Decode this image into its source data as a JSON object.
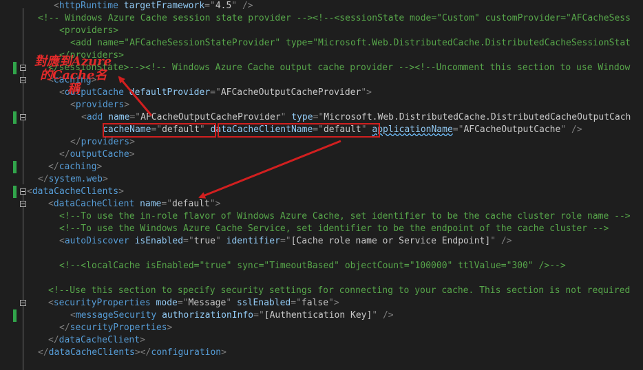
{
  "code_lines": [
    [
      [
        "p",
        "<"
      ],
      [
        "e",
        "httpRuntime"
      ],
      [
        "t",
        " "
      ],
      [
        "a",
        "targetFramework"
      ],
      [
        "p",
        "=\""
      ],
      [
        "v",
        "4.5"
      ],
      [
        "p",
        "\" />"
      ]
    ],
    [
      [
        "c",
        "<!-- Windows Azure Cache session state provider -->"
      ],
      [
        "c",
        "<!--<sessionState mode=\"Custom\" customProvider=\"AFCacheSess"
      ]
    ],
    [
      [
        "c",
        "<providers>"
      ]
    ],
    [
      [
        "c",
        "<add name=\"AFCacheSessionStateProvider\" type=\"Microsoft.Web.DistributedCache.DistributedCacheSessionStat"
      ]
    ],
    [
      [
        "c",
        "</providers>"
      ]
    ],
    [
      [
        "c",
        "</sessionState>-->"
      ],
      [
        "c",
        "<!-- Windows Azure Cache output cache provider -->"
      ],
      [
        "c",
        "<!--Uncomment this section to use Window"
      ]
    ],
    [
      [
        "p",
        "<"
      ],
      [
        "e",
        "caching"
      ],
      [
        "p",
        ">"
      ]
    ],
    [
      [
        "p",
        "<"
      ],
      [
        "e",
        "outputCache"
      ],
      [
        "t",
        " "
      ],
      [
        "a",
        "defaultProvider"
      ],
      [
        "p",
        "=\""
      ],
      [
        "v",
        "AFCacheOutputCacheProvider"
      ],
      [
        "p",
        "\">"
      ]
    ],
    [
      [
        "p",
        "<"
      ],
      [
        "e",
        "providers"
      ],
      [
        "p",
        ">"
      ]
    ],
    [
      [
        "p",
        "<"
      ],
      [
        "e",
        "add"
      ],
      [
        "t",
        " "
      ],
      [
        "a",
        "name"
      ],
      [
        "p",
        "=\""
      ],
      [
        "v",
        "AFCacheOutputCacheProvider"
      ],
      [
        "p",
        "\""
      ],
      [
        "t",
        " "
      ],
      [
        "a",
        "type"
      ],
      [
        "p",
        "=\""
      ],
      [
        "v",
        "Microsoft.Web.DistributedCache.DistributedCacheOutputCach"
      ]
    ],
    [
      [
        "a",
        "cacheName"
      ],
      [
        "p",
        "=\""
      ],
      [
        "v",
        "default"
      ],
      [
        "p",
        "\""
      ],
      [
        "t",
        " "
      ],
      [
        "a",
        "dataCacheClientName"
      ],
      [
        "p",
        "=\""
      ],
      [
        "v",
        "default"
      ],
      [
        "p",
        "\""
      ],
      [
        "t",
        " "
      ],
      [
        "a",
        "applicationName",
        "squig"
      ],
      [
        "p",
        "=\""
      ],
      [
        "v",
        "AFCacheOutputCache"
      ],
      [
        "p",
        "\" />"
      ]
    ],
    [
      [
        "p",
        "</"
      ],
      [
        "e",
        "providers"
      ],
      [
        "p",
        ">"
      ]
    ],
    [
      [
        "p",
        "</"
      ],
      [
        "e",
        "outputCache"
      ],
      [
        "p",
        ">"
      ]
    ],
    [
      [
        "p",
        "</"
      ],
      [
        "e",
        "caching"
      ],
      [
        "p",
        ">"
      ]
    ],
    [
      [
        "p",
        "</"
      ],
      [
        "e",
        "system.web"
      ],
      [
        "p",
        ">"
      ]
    ],
    [
      [
        "p",
        "<"
      ],
      [
        "e",
        "dataCacheClients"
      ],
      [
        "p",
        ">"
      ]
    ],
    [
      [
        "p",
        "<"
      ],
      [
        "e",
        "dataCacheClient"
      ],
      [
        "t",
        " "
      ],
      [
        "a",
        "name"
      ],
      [
        "p",
        "=\""
      ],
      [
        "v",
        "default"
      ],
      [
        "p",
        "\">"
      ]
    ],
    [
      [
        "c",
        "<!--To use the in-role flavor of Windows Azure Cache, set identifier to be the cache cluster role name -->"
      ]
    ],
    [
      [
        "c",
        "<!--To use the Windows Azure Cache Service, set identifier to be the endpoint of the cache cluster -->"
      ]
    ],
    [
      [
        "p",
        "<"
      ],
      [
        "e",
        "autoDiscover"
      ],
      [
        "t",
        " "
      ],
      [
        "a",
        "isEnabled"
      ],
      [
        "p",
        "=\""
      ],
      [
        "v",
        "true"
      ],
      [
        "p",
        "\""
      ],
      [
        "t",
        " "
      ],
      [
        "a",
        "identifier"
      ],
      [
        "p",
        "=\""
      ],
      [
        "v",
        "[Cache role name or Service Endpoint]"
      ],
      [
        "p",
        "\" />"
      ]
    ],
    [],
    [
      [
        "c",
        "<!--<localCache isEnabled=\"true\" sync=\"TimeoutBased\" objectCount=\"100000\" ttlValue=\"300\" />-->"
      ]
    ],
    [],
    [
      [
        "c",
        "<!--Use this section to specify security settings for connecting to your cache. This section is not required"
      ]
    ],
    [
      [
        "p",
        "<"
      ],
      [
        "e",
        "securityProperties"
      ],
      [
        "t",
        " "
      ],
      [
        "a",
        "mode"
      ],
      [
        "p",
        "=\""
      ],
      [
        "v",
        "Message"
      ],
      [
        "p",
        "\""
      ],
      [
        "t",
        " "
      ],
      [
        "a",
        "sslEnabled"
      ],
      [
        "p",
        "=\""
      ],
      [
        "v",
        "false"
      ],
      [
        "p",
        "\">"
      ]
    ],
    [
      [
        "p",
        "<"
      ],
      [
        "e",
        "messageSecurity"
      ],
      [
        "t",
        " "
      ],
      [
        "a",
        "authorizationInfo"
      ],
      [
        "p",
        "=\""
      ],
      [
        "v",
        "[Authentication Key]"
      ],
      [
        "p",
        "\" />"
      ]
    ],
    [
      [
        "p",
        "</"
      ],
      [
        "e",
        "securityProperties"
      ],
      [
        "p",
        ">"
      ]
    ],
    [
      [
        "p",
        "</"
      ],
      [
        "e",
        "dataCacheClient"
      ],
      [
        "p",
        ">"
      ]
    ],
    [
      [
        "p",
        "</"
      ],
      [
        "e",
        "dataCacheClients"
      ],
      [
        "p",
        ">"
      ],
      [
        "p",
        "</"
      ],
      [
        "e",
        "configuration"
      ],
      [
        "p",
        ">"
      ]
    ]
  ],
  "annotation": {
    "line1": "對應到Azure",
    "line2": "的Cache名",
    "line3": "稱"
  },
  "colors": {
    "background": "#1e1e1e",
    "punctuation": "#808080",
    "element": "#569cd6",
    "attribute": "#92caf4",
    "value": "#c8c8c8",
    "comment": "#57a64a",
    "change_mark": "#31a54b",
    "highlight": "#d11f1f"
  }
}
